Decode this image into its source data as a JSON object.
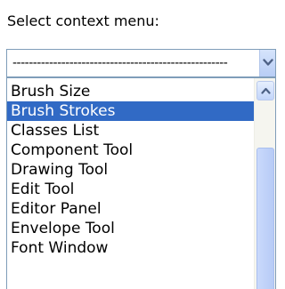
{
  "prompt_label": "Select context menu:",
  "combo": {
    "value": "-----------------------------------------------------",
    "dropdown_icon": "chevron-down-icon"
  },
  "list": {
    "items": [
      "Brush Size",
      "Brush Strokes",
      "Classes List",
      "Component Tool",
      "Drawing Tool",
      "Edit Tool",
      "Editor Panel",
      "Envelope Tool",
      "Font Window"
    ],
    "selected_index": 1
  },
  "colors": {
    "selection": "#316ac5",
    "border": "#7f9db9"
  }
}
